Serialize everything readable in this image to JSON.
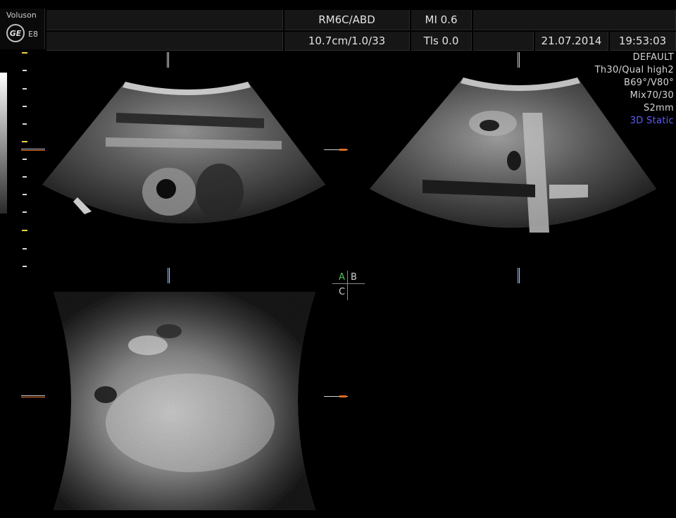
{
  "logo": {
    "brand": "Voluson",
    "mark": "GE",
    "model": "E8"
  },
  "header": {
    "probe": "RM6C/ABD",
    "mi": "MI 0.6",
    "settings": "10.7cm/1.0/33",
    "tis": "Tls 0.0",
    "date": "21.07.2014",
    "time": "19:53:03"
  },
  "info_panel": {
    "preset": "DEFAULT",
    "quality": "Th30/Qual high2",
    "angles": "B69°/V80°",
    "mix": "Mix70/30",
    "slice": "S2mm",
    "mode": "3D Static",
    "mode_color": "#5c5cff"
  },
  "planes": {
    "a": "A",
    "b": "B",
    "c": "C",
    "a_color": "#55c255"
  },
  "colors": {
    "background": "#000000",
    "marker": "#e06a1f",
    "scale_highlight": "#e8d34a"
  }
}
